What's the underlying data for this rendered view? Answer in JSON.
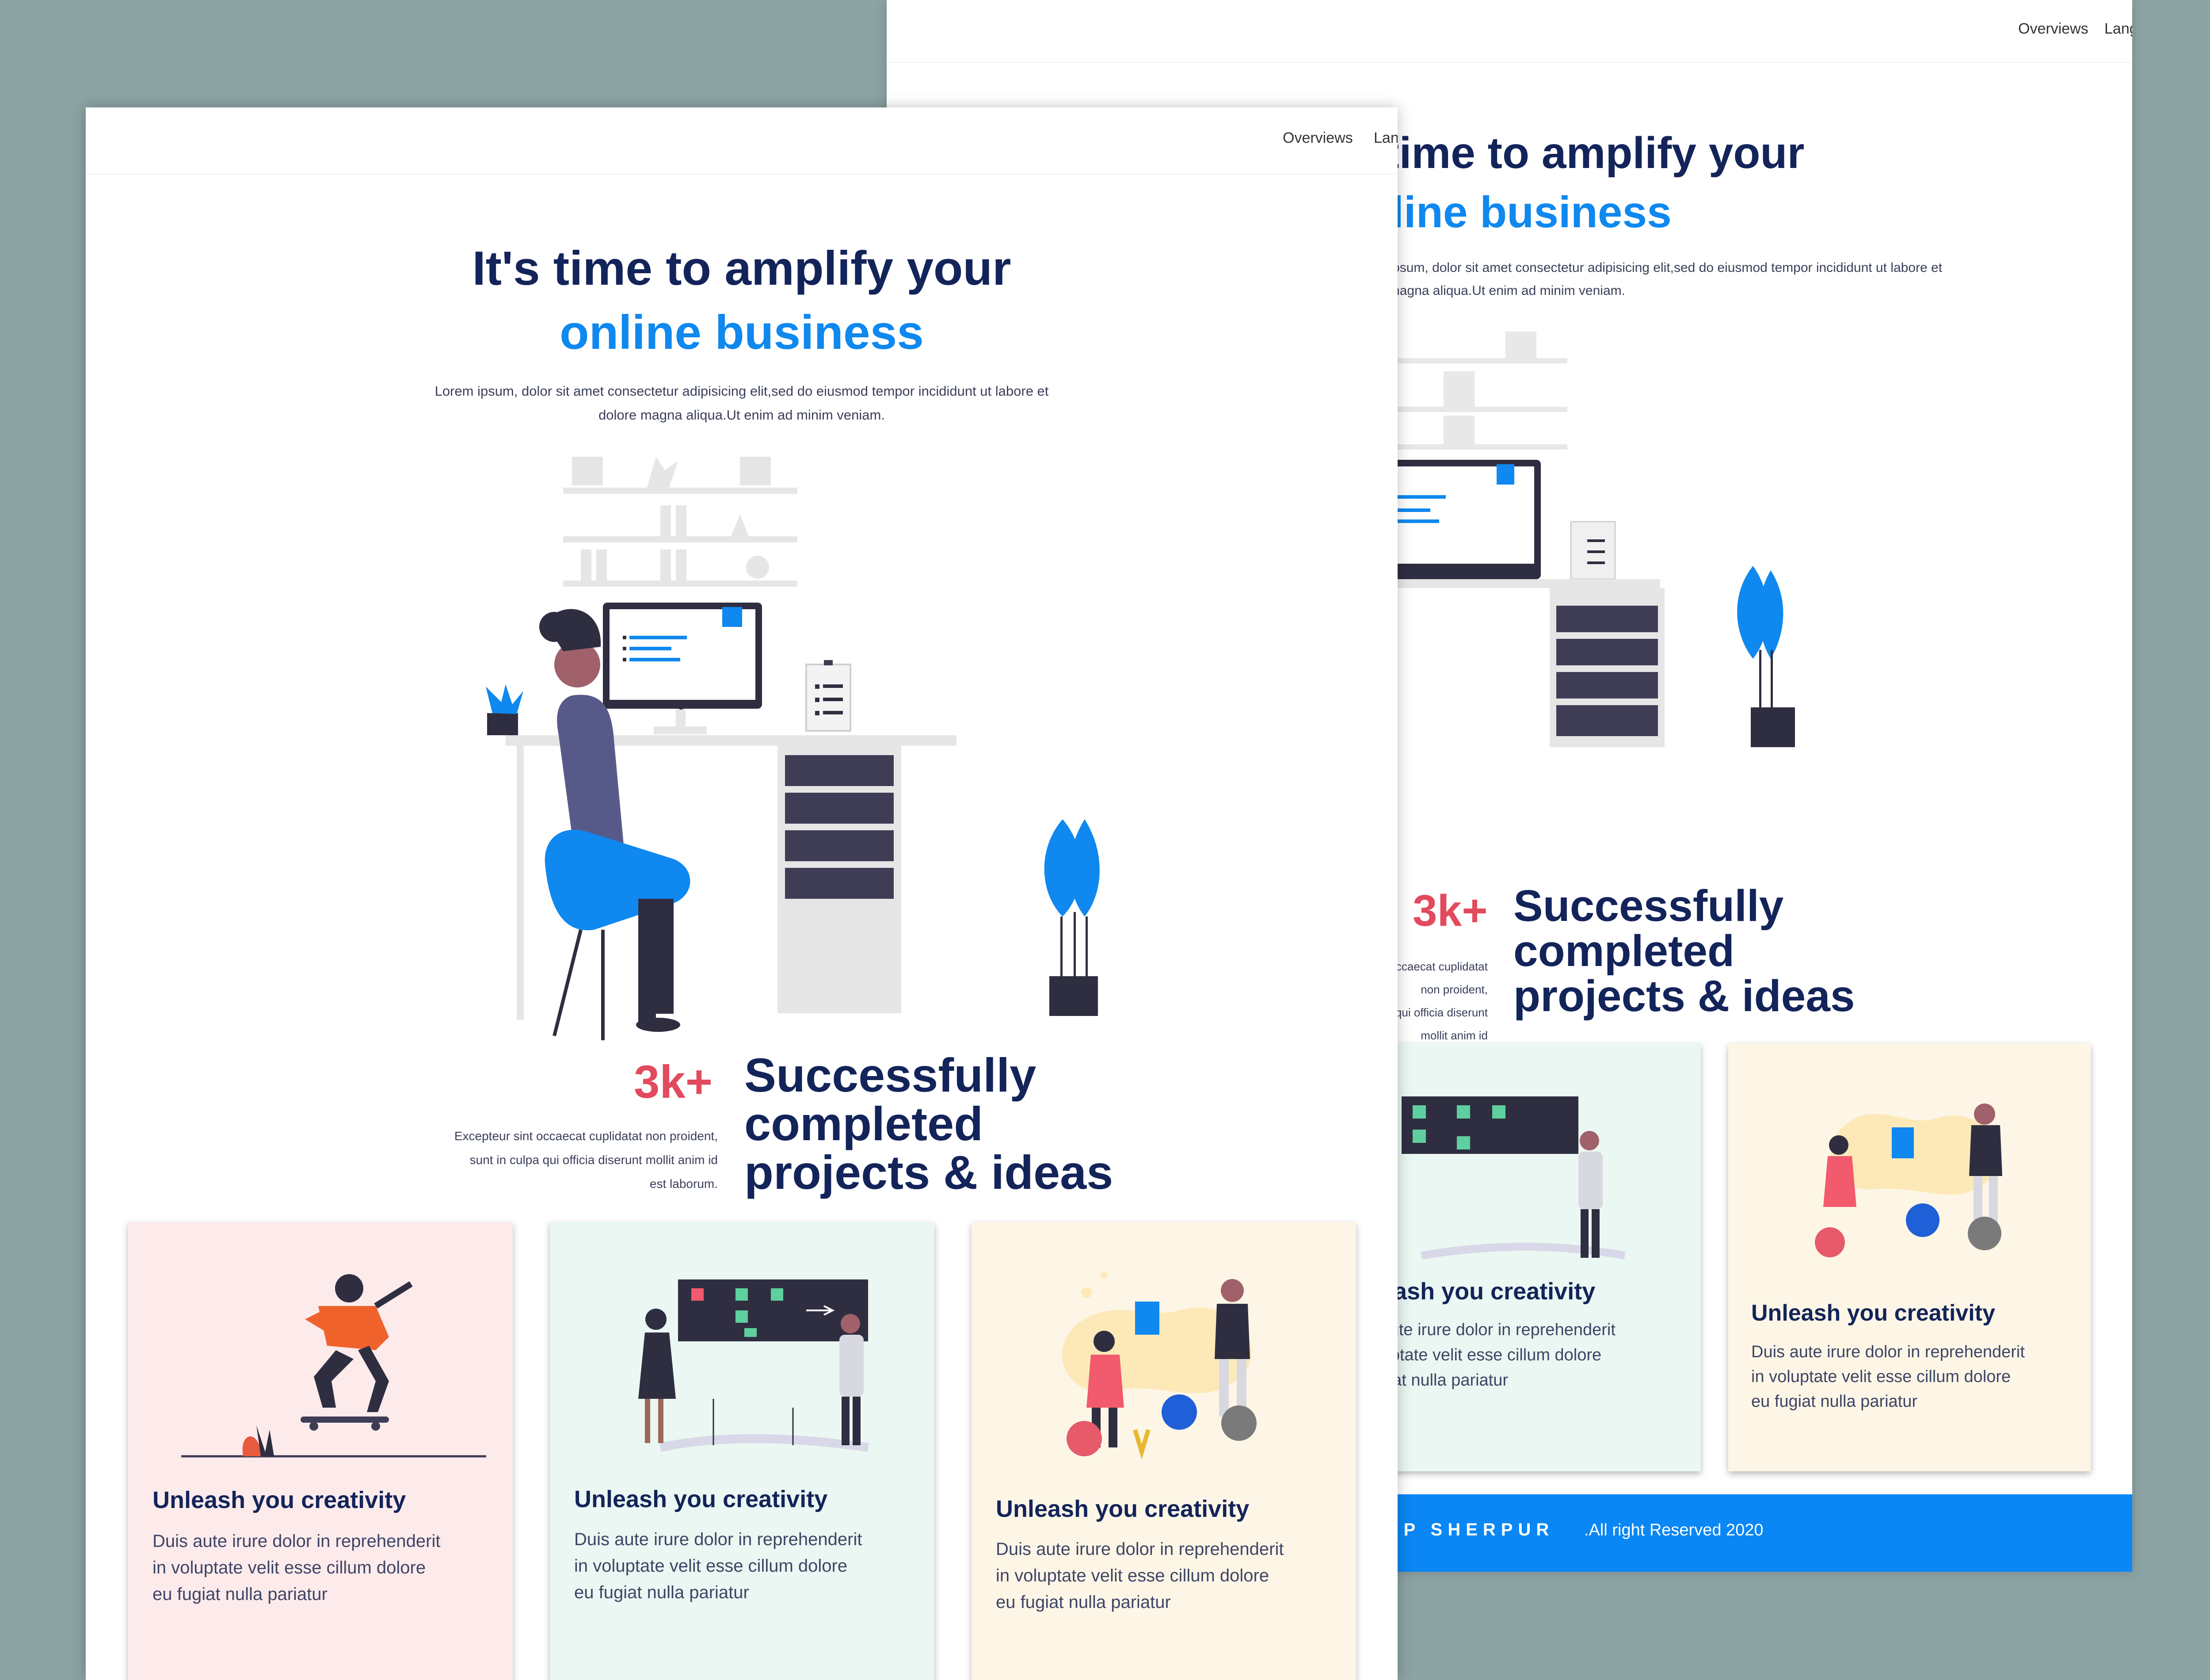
{
  "nav": {
    "overviews": "Overviews",
    "lang": "Lang"
  },
  "hero": {
    "title_line1": "It's time to amplify your",
    "title_line2": "online business",
    "lead_line1": "Lorem ipsum, dolor sit amet consectetur adipisicing elit,sed do eiusmod tempor incididunt ut labore et",
    "lead_line2": "dolore magna aliqua.Ut enim ad minim veniam."
  },
  "stats": {
    "number": "3k+",
    "headline_line1": "Successfully",
    "headline_line2": "completed",
    "headline_line3": "projects & ideas",
    "desc_line1": "Excepteur sint occaecat cuplidatat non proident,",
    "desc_line2": "sunt in culpa qui officia diserunt mollit anim id",
    "desc_line3": "est laborum."
  },
  "cards": [
    {
      "title": "Unleash you creativity",
      "line1": "Duis aute irure dolor in reprehenderit",
      "line2": "in voluptate velit esse cillum dolore",
      "line3": "eu fugiat nulla pariatur",
      "bg": "#fdebec"
    },
    {
      "title": "Unleash you creativity",
      "line1": "Duis aute irure dolor in reprehenderit",
      "line2": "in voluptate velit esse cillum dolore",
      "line3": "eu fugiat nulla pariatur",
      "bg": "#eaf7f2"
    },
    {
      "title": "Unleash you creativity",
      "line1": "Duis aute irure dolor in reprehenderit",
      "line2": "in voluptate velit esse cillum dolore",
      "line3": "eu fugiat nulla pariatur",
      "bg": "#fdf6e6"
    }
  ],
  "footer": {
    "brand": "EDP SHERPUR",
    "rights": ".All right Reserved 2020"
  },
  "colors": {
    "background": "#8ca3a4",
    "navy": "#13245a",
    "accent_blue": "#0f88ef",
    "stat_red": "#e24a5d",
    "footer_blue": "#0a87f4"
  },
  "icons": [
    "office-illustration",
    "skateboarder-illustration",
    "team-board-illustration",
    "social-icons-illustration"
  ]
}
